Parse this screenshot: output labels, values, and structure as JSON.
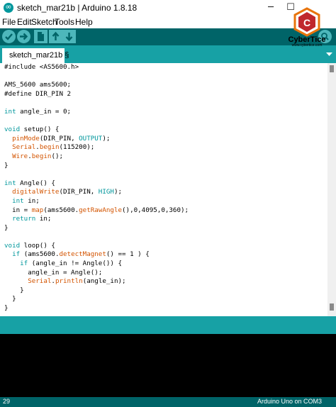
{
  "window": {
    "title": "sketch_mar21b | Arduino 1.8.18"
  },
  "menu": [
    "File",
    "Edit",
    "Sketch",
    "Tools",
    "Help"
  ],
  "toolbar": {
    "verify_icon": "checkmark-icon",
    "upload_icon": "arrow-right-icon",
    "new_icon": "new-file-icon",
    "open_icon": "arrow-up-icon",
    "save_icon": "arrow-down-icon",
    "serial_monitor_icon": "magnifier-icon"
  },
  "tab": {
    "label": "sketch_mar21b §"
  },
  "code": [
    "#include <AS5600.h>",
    "",
    "AMS_5600 ams5600;",
    "#define DIR_PIN 2",
    "",
    "int angle_in = 0;",
    "",
    "void setup() {",
    "  pinMode(DIR_PIN, OUTPUT);",
    "  Serial.begin(115200);",
    "  Wire.begin();",
    "}",
    "",
    "int Angle() {",
    "  digitalWrite(DIR_PIN, HIGH);",
    "  int in;",
    "  in = map(ams5600.getRawAngle(),0,4095,0,360);",
    "  return in;",
    "}",
    "",
    "void loop() {",
    "  if (ams5600.detectMagnet() == 1 ) {",
    "    if (angle_in != Angle()) {",
    "      angle_in = Angle();",
    "      Serial.println(angle_in);",
    "    }",
    "  }",
    "}"
  ],
  "status": {
    "line": "29",
    "board": "Arduino Uno on COM3"
  },
  "watermark": {
    "name": "CyberTice",
    "url": "www.cybertice.com"
  },
  "colors": {
    "teal_dark": "#006468",
    "teal": "#17a1a5",
    "button": "#4db7bb",
    "keyword": "#00979c",
    "function": "#d35400"
  }
}
